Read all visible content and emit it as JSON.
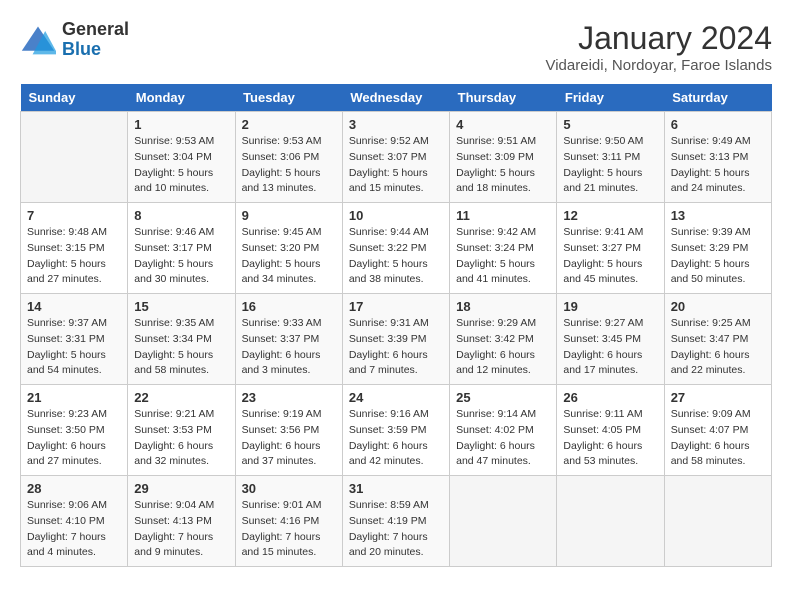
{
  "logo": {
    "general": "General",
    "blue": "Blue"
  },
  "title": "January 2024",
  "subtitle": "Vidareidi, Nordoyar, Faroe Islands",
  "weekdays": [
    "Sunday",
    "Monday",
    "Tuesday",
    "Wednesday",
    "Thursday",
    "Friday",
    "Saturday"
  ],
  "weeks": [
    [
      {
        "day": "",
        "sunrise": "",
        "sunset": "",
        "daylight": ""
      },
      {
        "day": "1",
        "sunrise": "Sunrise: 9:53 AM",
        "sunset": "Sunset: 3:04 PM",
        "daylight": "Daylight: 5 hours and 10 minutes."
      },
      {
        "day": "2",
        "sunrise": "Sunrise: 9:53 AM",
        "sunset": "Sunset: 3:06 PM",
        "daylight": "Daylight: 5 hours and 13 minutes."
      },
      {
        "day": "3",
        "sunrise": "Sunrise: 9:52 AM",
        "sunset": "Sunset: 3:07 PM",
        "daylight": "Daylight: 5 hours and 15 minutes."
      },
      {
        "day": "4",
        "sunrise": "Sunrise: 9:51 AM",
        "sunset": "Sunset: 3:09 PM",
        "daylight": "Daylight: 5 hours and 18 minutes."
      },
      {
        "day": "5",
        "sunrise": "Sunrise: 9:50 AM",
        "sunset": "Sunset: 3:11 PM",
        "daylight": "Daylight: 5 hours and 21 minutes."
      },
      {
        "day": "6",
        "sunrise": "Sunrise: 9:49 AM",
        "sunset": "Sunset: 3:13 PM",
        "daylight": "Daylight: 5 hours and 24 minutes."
      }
    ],
    [
      {
        "day": "7",
        "sunrise": "Sunrise: 9:48 AM",
        "sunset": "Sunset: 3:15 PM",
        "daylight": "Daylight: 5 hours and 27 minutes."
      },
      {
        "day": "8",
        "sunrise": "Sunrise: 9:46 AM",
        "sunset": "Sunset: 3:17 PM",
        "daylight": "Daylight: 5 hours and 30 minutes."
      },
      {
        "day": "9",
        "sunrise": "Sunrise: 9:45 AM",
        "sunset": "Sunset: 3:20 PM",
        "daylight": "Daylight: 5 hours and 34 minutes."
      },
      {
        "day": "10",
        "sunrise": "Sunrise: 9:44 AM",
        "sunset": "Sunset: 3:22 PM",
        "daylight": "Daylight: 5 hours and 38 minutes."
      },
      {
        "day": "11",
        "sunrise": "Sunrise: 9:42 AM",
        "sunset": "Sunset: 3:24 PM",
        "daylight": "Daylight: 5 hours and 41 minutes."
      },
      {
        "day": "12",
        "sunrise": "Sunrise: 9:41 AM",
        "sunset": "Sunset: 3:27 PM",
        "daylight": "Daylight: 5 hours and 45 minutes."
      },
      {
        "day": "13",
        "sunrise": "Sunrise: 9:39 AM",
        "sunset": "Sunset: 3:29 PM",
        "daylight": "Daylight: 5 hours and 50 minutes."
      }
    ],
    [
      {
        "day": "14",
        "sunrise": "Sunrise: 9:37 AM",
        "sunset": "Sunset: 3:31 PM",
        "daylight": "Daylight: 5 hours and 54 minutes."
      },
      {
        "day": "15",
        "sunrise": "Sunrise: 9:35 AM",
        "sunset": "Sunset: 3:34 PM",
        "daylight": "Daylight: 5 hours and 58 minutes."
      },
      {
        "day": "16",
        "sunrise": "Sunrise: 9:33 AM",
        "sunset": "Sunset: 3:37 PM",
        "daylight": "Daylight: 6 hours and 3 minutes."
      },
      {
        "day": "17",
        "sunrise": "Sunrise: 9:31 AM",
        "sunset": "Sunset: 3:39 PM",
        "daylight": "Daylight: 6 hours and 7 minutes."
      },
      {
        "day": "18",
        "sunrise": "Sunrise: 9:29 AM",
        "sunset": "Sunset: 3:42 PM",
        "daylight": "Daylight: 6 hours and 12 minutes."
      },
      {
        "day": "19",
        "sunrise": "Sunrise: 9:27 AM",
        "sunset": "Sunset: 3:45 PM",
        "daylight": "Daylight: 6 hours and 17 minutes."
      },
      {
        "day": "20",
        "sunrise": "Sunrise: 9:25 AM",
        "sunset": "Sunset: 3:47 PM",
        "daylight": "Daylight: 6 hours and 22 minutes."
      }
    ],
    [
      {
        "day": "21",
        "sunrise": "Sunrise: 9:23 AM",
        "sunset": "Sunset: 3:50 PM",
        "daylight": "Daylight: 6 hours and 27 minutes."
      },
      {
        "day": "22",
        "sunrise": "Sunrise: 9:21 AM",
        "sunset": "Sunset: 3:53 PM",
        "daylight": "Daylight: 6 hours and 32 minutes."
      },
      {
        "day": "23",
        "sunrise": "Sunrise: 9:19 AM",
        "sunset": "Sunset: 3:56 PM",
        "daylight": "Daylight: 6 hours and 37 minutes."
      },
      {
        "day": "24",
        "sunrise": "Sunrise: 9:16 AM",
        "sunset": "Sunset: 3:59 PM",
        "daylight": "Daylight: 6 hours and 42 minutes."
      },
      {
        "day": "25",
        "sunrise": "Sunrise: 9:14 AM",
        "sunset": "Sunset: 4:02 PM",
        "daylight": "Daylight: 6 hours and 47 minutes."
      },
      {
        "day": "26",
        "sunrise": "Sunrise: 9:11 AM",
        "sunset": "Sunset: 4:05 PM",
        "daylight": "Daylight: 6 hours and 53 minutes."
      },
      {
        "day": "27",
        "sunrise": "Sunrise: 9:09 AM",
        "sunset": "Sunset: 4:07 PM",
        "daylight": "Daylight: 6 hours and 58 minutes."
      }
    ],
    [
      {
        "day": "28",
        "sunrise": "Sunrise: 9:06 AM",
        "sunset": "Sunset: 4:10 PM",
        "daylight": "Daylight: 7 hours and 4 minutes."
      },
      {
        "day": "29",
        "sunrise": "Sunrise: 9:04 AM",
        "sunset": "Sunset: 4:13 PM",
        "daylight": "Daylight: 7 hours and 9 minutes."
      },
      {
        "day": "30",
        "sunrise": "Sunrise: 9:01 AM",
        "sunset": "Sunset: 4:16 PM",
        "daylight": "Daylight: 7 hours and 15 minutes."
      },
      {
        "day": "31",
        "sunrise": "Sunrise: 8:59 AM",
        "sunset": "Sunset: 4:19 PM",
        "daylight": "Daylight: 7 hours and 20 minutes."
      },
      {
        "day": "",
        "sunrise": "",
        "sunset": "",
        "daylight": ""
      },
      {
        "day": "",
        "sunrise": "",
        "sunset": "",
        "daylight": ""
      },
      {
        "day": "",
        "sunrise": "",
        "sunset": "",
        "daylight": ""
      }
    ]
  ]
}
